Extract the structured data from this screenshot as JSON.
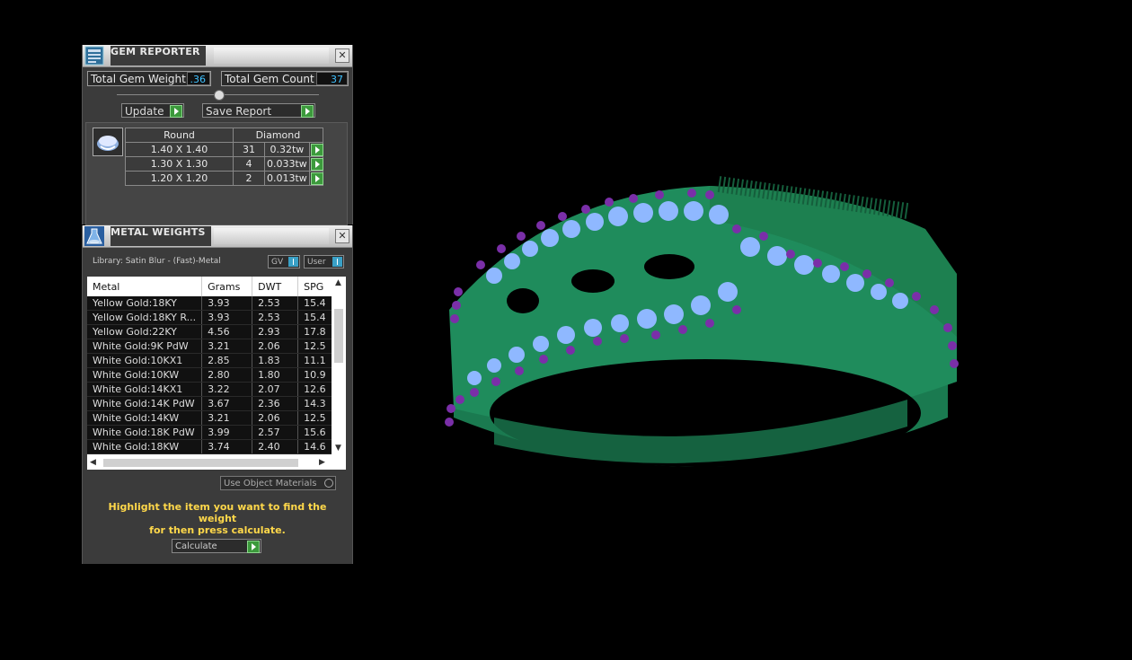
{
  "gem_reporter": {
    "title": "GEM REPORTER",
    "total_gem_weight_label": "Total Gem Weight",
    "total_gem_weight_value": ".36",
    "total_gem_count_label": "Total Gem Count",
    "total_gem_count_value": "37",
    "update_label": "Update",
    "save_report_label": "Save Report",
    "shape_header": "Round",
    "material_header": "Diamond",
    "rows": [
      {
        "size": "1.40 X 1.40",
        "count": "31",
        "weight": "0.32tw"
      },
      {
        "size": "1.30 X 1.30",
        "count": "4",
        "weight": "0.033tw"
      },
      {
        "size": "1.20 X 1.20",
        "count": "2",
        "weight": "0.013tw"
      }
    ]
  },
  "metal_weights": {
    "title": "METAL WEIGHTS",
    "library": "Library: Satin Blur - (Fast)-Metal",
    "gv_label": "GV",
    "user_label": "User",
    "columns": [
      "Metal",
      "Grams",
      "DWT",
      "SPG"
    ],
    "rows": [
      {
        "metal": "Yellow Gold:18KY",
        "grams": "3.93",
        "dwt": "2.53",
        "spg": "15.4"
      },
      {
        "metal": "Yellow Gold:18KY R...",
        "grams": "3.93",
        "dwt": "2.53",
        "spg": "15.4"
      },
      {
        "metal": "Yellow Gold:22KY",
        "grams": "4.56",
        "dwt": "2.93",
        "spg": "17.8"
      },
      {
        "metal": "White Gold:9K PdW",
        "grams": "3.21",
        "dwt": "2.06",
        "spg": "12.5"
      },
      {
        "metal": "White Gold:10KX1",
        "grams": "2.85",
        "dwt": "1.83",
        "spg": "11.1"
      },
      {
        "metal": "White Gold:10KW",
        "grams": "2.80",
        "dwt": "1.80",
        "spg": "10.9"
      },
      {
        "metal": "White Gold:14KX1",
        "grams": "3.22",
        "dwt": "2.07",
        "spg": "12.6"
      },
      {
        "metal": "White Gold:14K PdW",
        "grams": "3.67",
        "dwt": "2.36",
        "spg": "14.3"
      },
      {
        "metal": "White Gold:14KW",
        "grams": "3.21",
        "dwt": "2.06",
        "spg": "12.5"
      },
      {
        "metal": "White Gold:18K PdW",
        "grams": "3.99",
        "dwt": "2.57",
        "spg": "15.6"
      },
      {
        "metal": "White Gold:18KW",
        "grams": "3.74",
        "dwt": "2.40",
        "spg": "14.6"
      }
    ],
    "use_object_materials_label": "Use Object Materials",
    "hint_line1": "Highlight the item you want to find the weight",
    "hint_line2": "for then press calculate.",
    "calculate_label": "Calculate"
  },
  "colors": {
    "ring_metal": "#1f8c5c",
    "gem_diamond": "#8fb8ff",
    "gem_prong": "#7a2fa8",
    "accent_value": "#3fc1ff",
    "hint_text": "#ffd84a",
    "go_button": "#3c9a3c"
  }
}
